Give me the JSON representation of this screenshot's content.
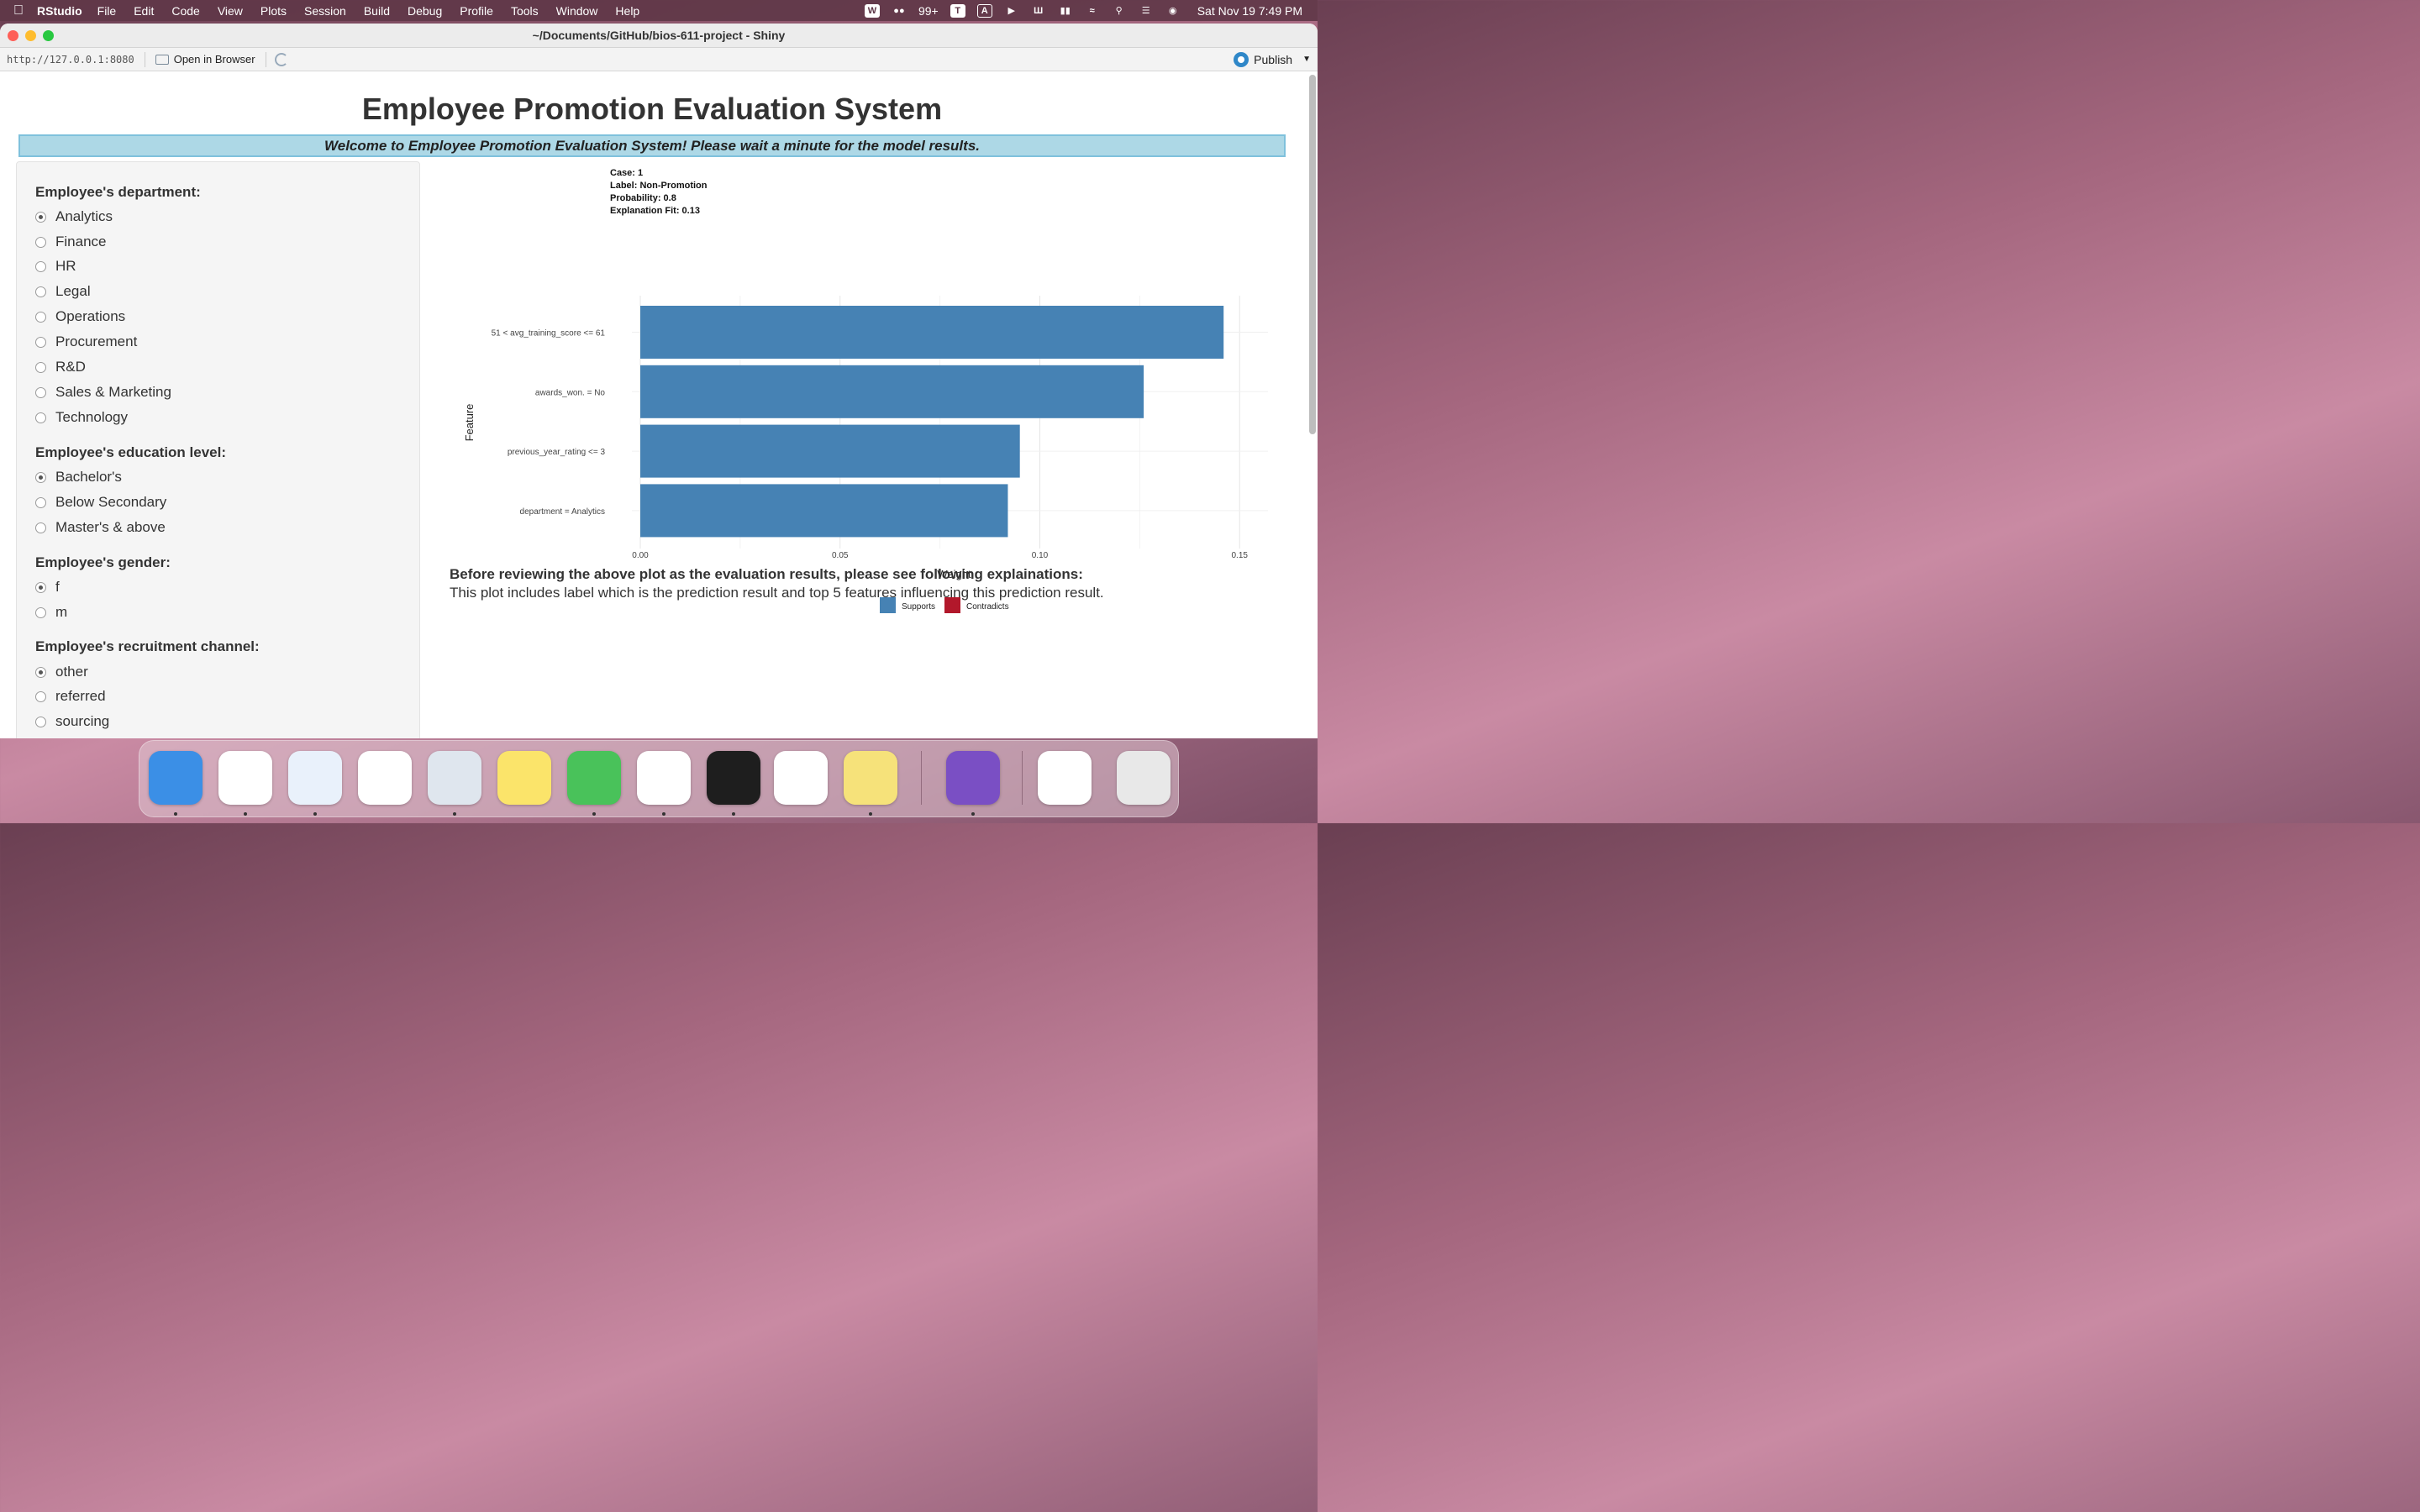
{
  "menubar": {
    "app_name": "RStudio",
    "menus": [
      "File",
      "Edit",
      "Code",
      "View",
      "Plots",
      "Session",
      "Build",
      "Debug",
      "Profile",
      "Tools",
      "Window",
      "Help"
    ],
    "wechat_badge": "99+",
    "clock": "Sat Nov 19  7:49 PM"
  },
  "window": {
    "title": "~/Documents/GitHub/bios-611-project - Shiny"
  },
  "toolbar": {
    "url": "http://127.0.0.1:8080",
    "open_label": "Open in Browser",
    "publish_label": "Publish"
  },
  "app": {
    "title": "Employee Promotion Evaluation System",
    "welcome": "Welcome to Employee Promotion Evaluation System! Please wait a minute for the model results."
  },
  "sidebar": {
    "groups": [
      {
        "label": "Employee's department:",
        "options": [
          "Analytics",
          "Finance",
          "HR",
          "Legal",
          "Operations",
          "Procurement",
          "R&D",
          "Sales & Marketing",
          "Technology"
        ],
        "selected": "Analytics"
      },
      {
        "label": "Employee's education level:",
        "options": [
          "Bachelor's",
          "Below Secondary",
          "Master's & above"
        ],
        "selected": "Bachelor's"
      },
      {
        "label": "Employee's gender:",
        "options": [
          "f",
          "m"
        ],
        "selected": "f"
      },
      {
        "label": "Employee's recruitment channel:",
        "options": [
          "other",
          "referred",
          "sourcing"
        ],
        "selected": "other"
      }
    ]
  },
  "chart_data": {
    "type": "bar",
    "orientation": "horizontal",
    "header": [
      "Case: 1",
      "Label: Non-Promotion",
      "Probability: 0.8",
      "Explanation Fit: 0.13"
    ],
    "categories": [
      "51 < avg_training_score <= 61",
      "awards_won. = No",
      "previous_year_rating <= 3",
      "department = Analytics"
    ],
    "series": [
      {
        "name": "Supports",
        "values": [
          0.146,
          0.126,
          0.095,
          0.092
        ],
        "color": "#4682b4"
      }
    ],
    "legend": [
      {
        "name": "Supports",
        "color": "#4682b4"
      },
      {
        "name": "Contradicts",
        "color": "#b2182b"
      }
    ],
    "legend_position": "bottom",
    "xlabel": "Weight",
    "ylabel": "Feature",
    "xlim": [
      0,
      0.155
    ],
    "xticks": [
      "0.00",
      "0.05",
      "0.10",
      "0.15"
    ],
    "xtick_values": [
      0,
      0.05,
      0.1,
      0.15
    ],
    "grid": true
  },
  "explanation": {
    "heading": "Before reviewing the above plot as the evaluation results, please see following explainations:",
    "body": "This plot includes label which is the prediction result and top 5 features influencing this prediction result."
  },
  "dock": {
    "apps": [
      {
        "name": "finder-icon",
        "color": "#3b8fe6",
        "running": true
      },
      {
        "name": "wps-office-icon",
        "color": "#ffffff",
        "running": true
      },
      {
        "name": "safari-icon",
        "color": "#e9f1fb",
        "running": true
      },
      {
        "name": "vscode-icon",
        "color": "#ffffff",
        "running": false
      },
      {
        "name": "rstudio-icon",
        "color": "#dfe6ee",
        "running": true
      },
      {
        "name": "music-icon",
        "color": "#fbe46a",
        "running": false
      },
      {
        "name": "wechat-icon",
        "color": "#49c25a",
        "running": true
      },
      {
        "name": "chrome-icon",
        "color": "#ffffff",
        "running": true
      },
      {
        "name": "terminal-icon",
        "color": "#1e1e1e",
        "running": true
      },
      {
        "name": "avatar-app-icon",
        "color": "#ffffff",
        "running": false
      },
      {
        "name": "stickies-icon",
        "color": "#f6e27a",
        "running": true
      },
      {
        "name": "github-desktop-icon",
        "color": "#7a4fc4",
        "running": true
      },
      {
        "name": "preview-window-icon",
        "color": "#ffffff",
        "running": false
      },
      {
        "name": "trash-icon",
        "color": "#e8e8e8",
        "running": false
      }
    ]
  }
}
